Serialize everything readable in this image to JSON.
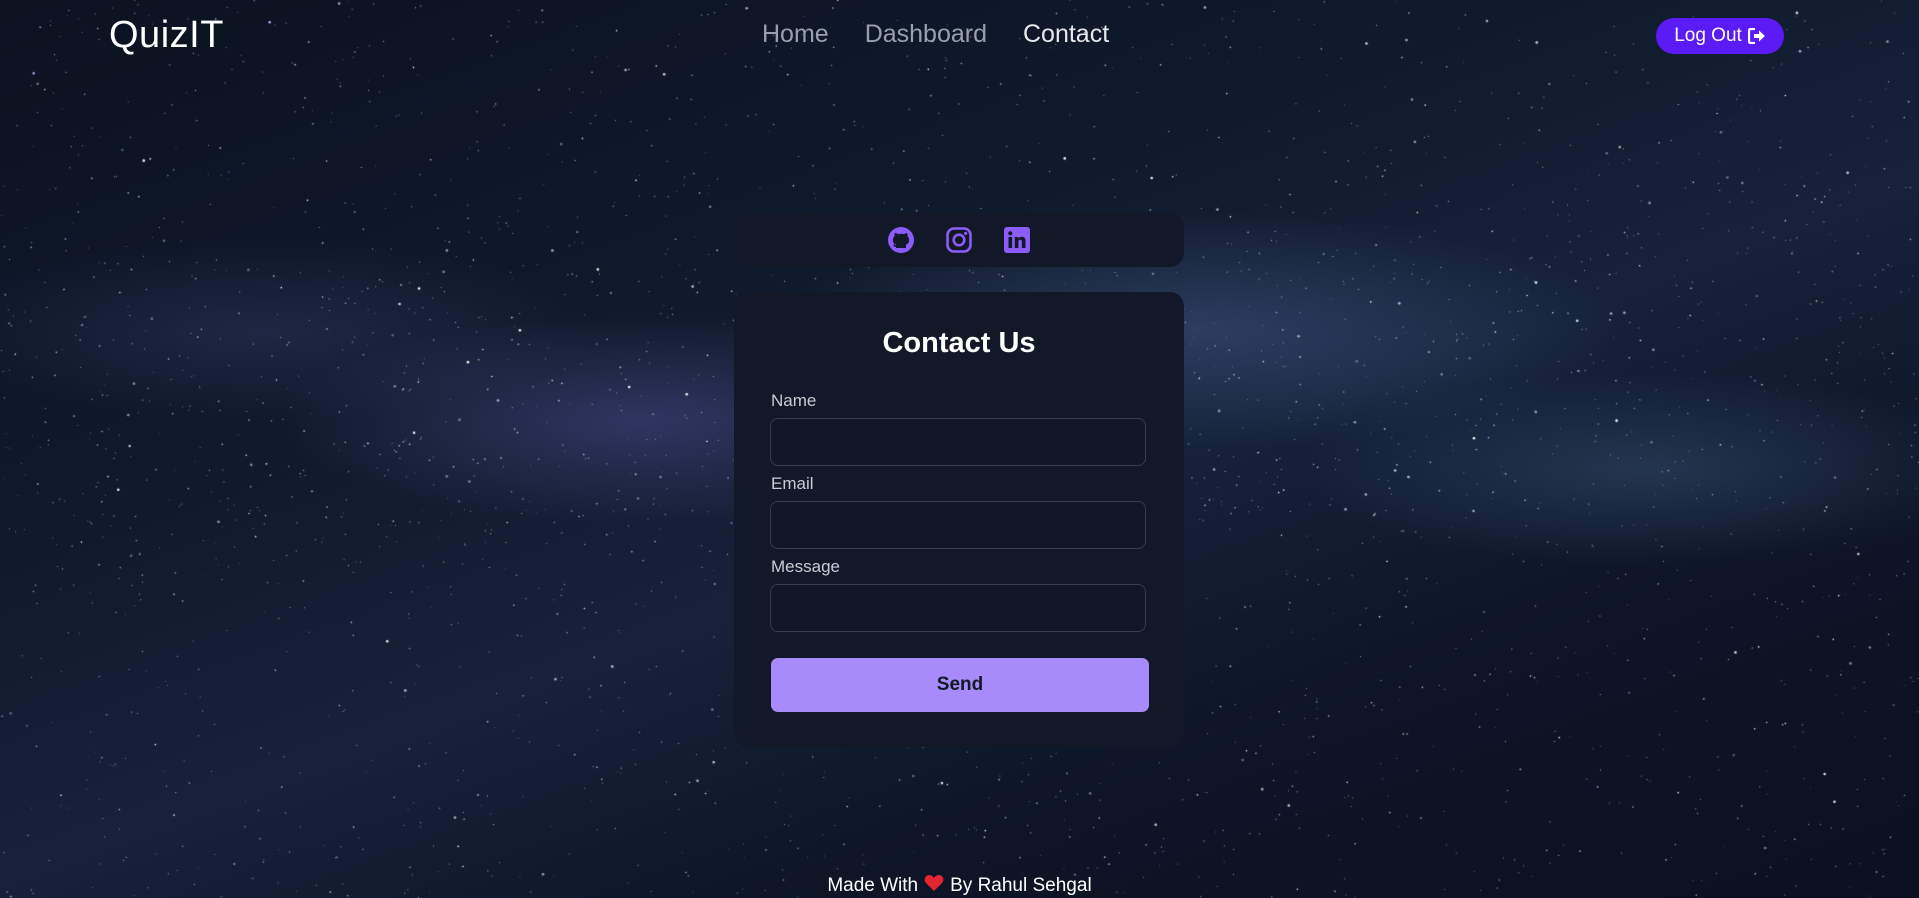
{
  "navbar": {
    "brand": "QuizIT",
    "links": [
      {
        "label": "Home",
        "active": false
      },
      {
        "label": "Dashboard",
        "active": false
      },
      {
        "label": "Contact",
        "active": true
      }
    ],
    "logout_label": "Log Out",
    "logout_icon": "sign-out-icon"
  },
  "social": {
    "icons": [
      "github-icon",
      "instagram-icon",
      "linkedin-icon"
    ],
    "color": "#8b5cf6"
  },
  "contact_form": {
    "title": "Contact Us",
    "fields": [
      {
        "label": "Name",
        "value": "",
        "placeholder": ""
      },
      {
        "label": "Email",
        "value": "",
        "placeholder": ""
      },
      {
        "label": "Message",
        "value": "",
        "placeholder": ""
      }
    ],
    "submit_label": "Send"
  },
  "footer": {
    "prefix": "Made With",
    "icon": "heart-icon",
    "suffix": "By Rahul Sehgal"
  },
  "colors": {
    "accent": "#5b1bf5",
    "button": "#a78bfa",
    "card": "#121828",
    "heart": "#e3262f"
  }
}
